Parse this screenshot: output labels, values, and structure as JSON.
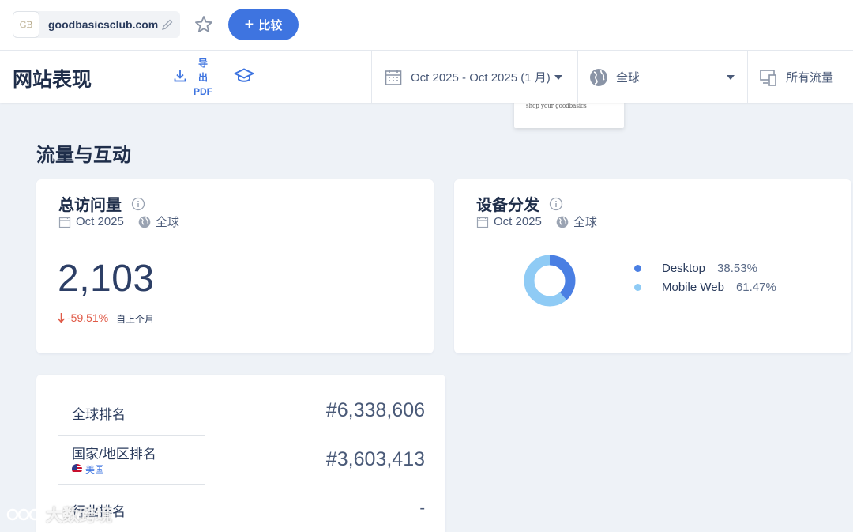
{
  "header": {
    "domain": "goodbasicsclub.com",
    "favicon_text": "GB",
    "compare_label": "比较"
  },
  "subheader": {
    "title": "网站表现",
    "export_label_line1": "导",
    "export_label_line2": "出",
    "export_label_line3": "PDF",
    "date_range": "Oct 2025 - Oct 2025 (1 月)",
    "region": "全球",
    "traffic": "所有流量"
  },
  "ad_preview": {
    "text": "shop your goodbasics"
  },
  "section": {
    "title": "流量与互动"
  },
  "visits_card": {
    "title": "总访问量",
    "period": "Oct 2025",
    "region": "全球",
    "value": "2,103",
    "change": "-59.51%",
    "change_label": "自上个月"
  },
  "devices_card": {
    "title": "设备分发",
    "period": "Oct 2025",
    "region": "全球",
    "chart_data": {
      "type": "pie",
      "categories": [
        "Desktop",
        "Mobile Web"
      ],
      "values": [
        38.53,
        61.47
      ],
      "colors": [
        "#4a7fe3",
        "#8fcbf5"
      ]
    },
    "legend": [
      {
        "label": "Desktop",
        "pct": "38.53%",
        "color": "#4a7fe3"
      },
      {
        "label": "Mobile Web",
        "pct": "61.47%",
        "color": "#8fcbf5"
      }
    ]
  },
  "ranks": {
    "global_label": "全球排名",
    "global_value": "#6,338,606",
    "country_label": "国家/地区排名",
    "country_name": "美国",
    "country_value": "#3,603,413",
    "industry_label": "行业排名",
    "industry_value": "-"
  },
  "watermark": {
    "text": "大数跨境"
  },
  "colors": {
    "accent": "#3e74e0",
    "negative": "#e05a47"
  }
}
